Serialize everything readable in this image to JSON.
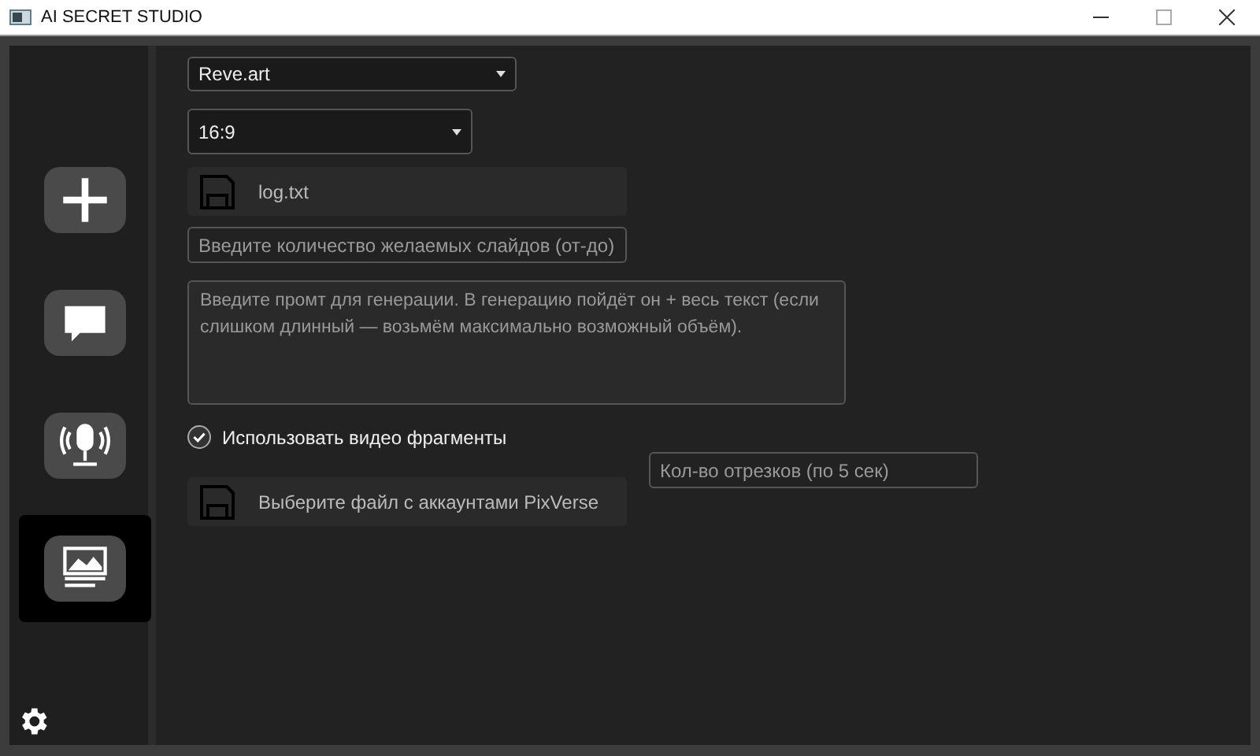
{
  "window": {
    "title": "AI SECRET STUDIO"
  },
  "sidebar": {
    "items": [
      {
        "kind": "plus",
        "selected": false
      },
      {
        "kind": "chat",
        "selected": false
      },
      {
        "kind": "mic",
        "selected": false
      },
      {
        "kind": "gallery",
        "selected": true
      }
    ]
  },
  "form": {
    "service_dropdown": {
      "value": "Reve.art"
    },
    "ratio_dropdown": {
      "value": "16:9"
    },
    "log_file_button": {
      "label": "log.txt"
    },
    "slides_field": {
      "placeholder": "Введите количество желаемых слайдов (от-до)"
    },
    "prompt_field": {
      "placeholder": "Введите промт для генерации. В генерацию пойдёт он + весь текст (если слишком длинный — возьмём максимально возможный объём)."
    },
    "video_checkbox": {
      "label": "Использовать видео фрагменты",
      "checked": true
    },
    "accounts_file_button": {
      "label": "Выберите файл с аккаунтами PixVerse"
    },
    "segments_field": {
      "placeholder": "Кол-во отрезков (по 5 сек)"
    }
  }
}
